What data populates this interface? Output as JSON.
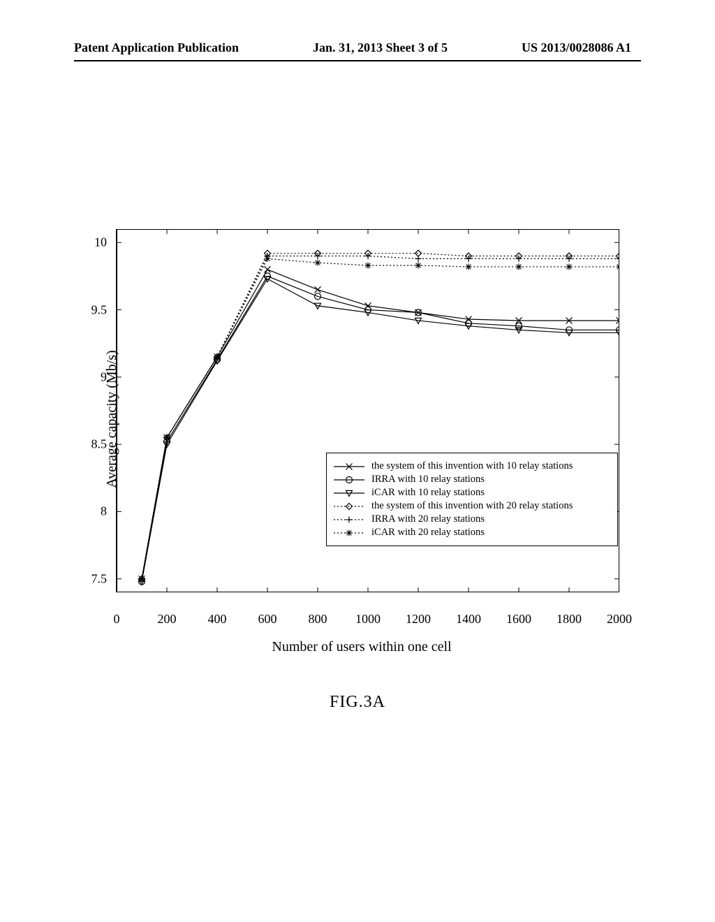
{
  "header": {
    "left": "Patent Application Publication",
    "mid": "Jan. 31, 2013  Sheet 3 of 5",
    "right": "US 2013/0028086 A1"
  },
  "figure_caption": "FIG.3A",
  "chart_data": {
    "type": "line",
    "xlabel": "Number of users within one cell",
    "ylabel": "Average capacity (Mb/s)",
    "xlim": [
      0,
      2000
    ],
    "ylim": [
      7.4,
      10.1
    ],
    "xticks": [
      0,
      200,
      400,
      600,
      800,
      1000,
      1200,
      1400,
      1600,
      1800,
      2000
    ],
    "yticks": [
      7.5,
      8,
      8.5,
      9,
      9.5,
      10
    ],
    "categories": [
      100,
      200,
      400,
      600,
      800,
      1000,
      1200,
      1400,
      1600,
      1800,
      2000
    ],
    "series": [
      {
        "name": "the system of this invention with 10 relay stations",
        "marker": "x",
        "style": "solid",
        "values": [
          7.5,
          8.55,
          9.15,
          9.8,
          9.65,
          9.53,
          9.48,
          9.43,
          9.42,
          9.42,
          9.42
        ]
      },
      {
        "name": "IRRA with 10 relay stations",
        "marker": "circle",
        "style": "solid",
        "values": [
          7.48,
          8.52,
          9.13,
          9.75,
          9.6,
          9.5,
          9.48,
          9.4,
          9.38,
          9.35,
          9.35
        ]
      },
      {
        "name": "iCAR with 10 relay stations",
        "marker": "triangle",
        "style": "solid",
        "values": [
          7.48,
          8.5,
          9.12,
          9.73,
          9.53,
          9.48,
          9.42,
          9.38,
          9.35,
          9.33,
          9.33
        ]
      },
      {
        "name": "the system of this invention with 20 relay stations",
        "marker": "diamond",
        "style": "dotted",
        "values": [
          7.5,
          8.55,
          9.15,
          9.92,
          9.92,
          9.92,
          9.92,
          9.9,
          9.9,
          9.9,
          9.9
        ]
      },
      {
        "name": "IRRA with 20 relay stations",
        "marker": "plus",
        "style": "dotted",
        "values": [
          7.5,
          8.55,
          9.15,
          9.9,
          9.9,
          9.9,
          9.88,
          9.88,
          9.88,
          9.88,
          9.88
        ]
      },
      {
        "name": "iCAR with 20 relay stations",
        "marker": "asterisk",
        "style": "dotted",
        "values": [
          7.5,
          8.55,
          9.15,
          9.88,
          9.85,
          9.83,
          9.83,
          9.82,
          9.82,
          9.82,
          9.82
        ]
      }
    ]
  }
}
